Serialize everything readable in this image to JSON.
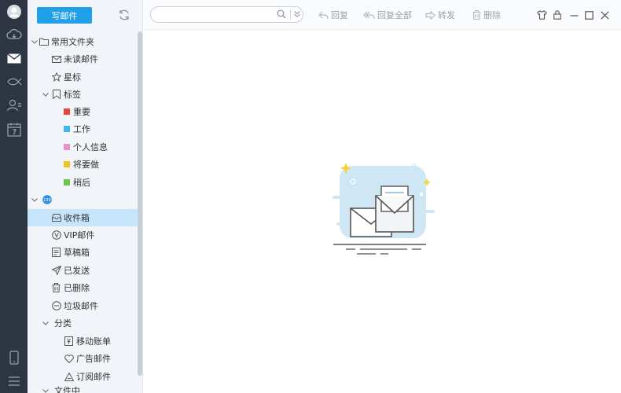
{
  "toolbar": {
    "compose_label": "写邮件",
    "search_placeholder": "",
    "reply_label": "回复",
    "reply_all_label": "回复全部",
    "forward_label": "转发",
    "delete_label": "删除"
  },
  "folders": {
    "common": {
      "title": "常用文件夹",
      "unread": "未读邮件",
      "starred": "星标",
      "tags": "标签",
      "tag_items": [
        {
          "label": "重要",
          "color": "#e8463f"
        },
        {
          "label": "工作",
          "color": "#3fb7e8"
        },
        {
          "label": "个人信息",
          "color": "#e88fd0"
        },
        {
          "label": "将要做",
          "color": "#f2c31c"
        },
        {
          "label": "稍后",
          "color": "#6dc84a"
        }
      ]
    },
    "account": {
      "badge": "139",
      "inbox": "收件箱",
      "vip": "VIP邮件",
      "drafts": "草稿箱",
      "sent": "已发送",
      "deleted": "已删除",
      "spam": "垃圾邮件",
      "categories": "分类",
      "category_items": [
        "移动账单",
        "广告邮件",
        "订阅邮件"
      ],
      "file_center": "文件中"
    }
  },
  "colors": {
    "accent": "#1fa0e8",
    "rail": "#2e3542",
    "selection": "#c7e5fa"
  },
  "icons": [
    "avatar-icon",
    "cloud-icon",
    "mail-icon",
    "fish-icon",
    "contacts-icon",
    "calendar-icon",
    "phone-icon",
    "menu-icon"
  ]
}
